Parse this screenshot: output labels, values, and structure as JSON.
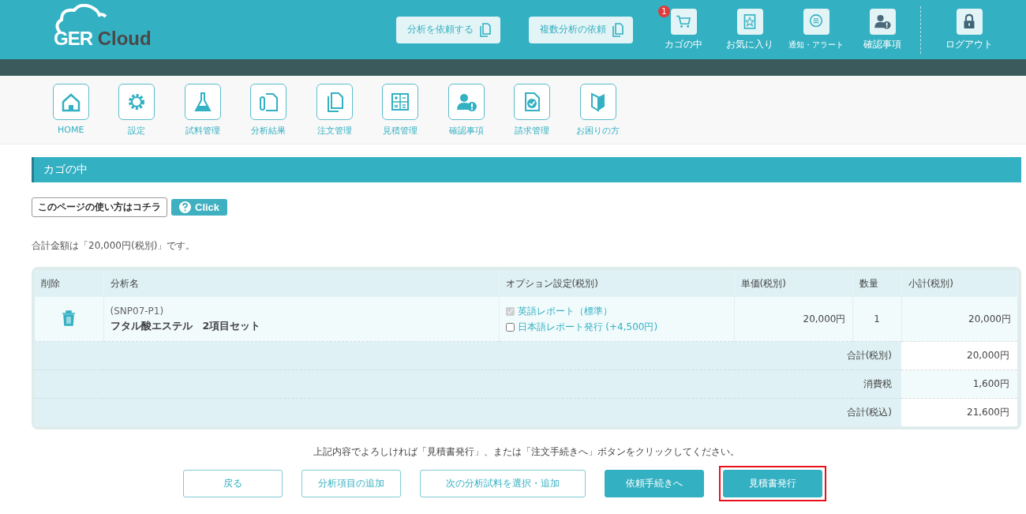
{
  "header": {
    "logo": {
      "part_1": "GER",
      "part_2": "Cloud"
    },
    "request_buttons": [
      "分析を依頼する",
      "複数分析の依頼"
    ],
    "icons": [
      {
        "label": "カゴの中",
        "badge": "1"
      },
      {
        "label": "お気に入り"
      },
      {
        "label": "通知・アラート"
      },
      {
        "label": "確認事項"
      }
    ],
    "logout": "ログアウト"
  },
  "nav": [
    "HOME",
    "設定",
    "試料管理",
    "分析結果",
    "注文管理",
    "見積管理",
    "確認事項",
    "請求管理",
    "お困りの方"
  ],
  "page_title": "カゴの中",
  "help": {
    "label": "このページの使い方はコチラ",
    "button": "Click"
  },
  "total_text": "合計金額は「20,000円(税別)」です。",
  "table": {
    "columns": [
      "削除",
      "分析名",
      "オプション設定(税別)",
      "単価(税別)",
      "数量",
      "小計(税別)"
    ],
    "rows": [
      {
        "code": "(SNP07-P1)",
        "name": "フタル酸エステル　2項目セット",
        "options": [
          {
            "label": "英語レポート（標準）",
            "checked": true,
            "disabled": true
          },
          {
            "label": "日本語レポート発行 (+4,500円)",
            "checked": false,
            "disabled": false
          }
        ],
        "price": "20,000円",
        "qty": "1",
        "subtotal": "20,000円"
      }
    ],
    "summary": [
      {
        "label": "合計(税別)",
        "value": "20,000円"
      },
      {
        "label": "消費税",
        "value": "1,600円"
      },
      {
        "label": "合計(税込)",
        "value": "21,600円"
      }
    ]
  },
  "message": "上記内容でよろしければ「見積書発行」、または「注文手続きへ」ボタンをクリックしてください。",
  "buttons": [
    {
      "label": "戻る",
      "kind": "outline",
      "highlighted": false
    },
    {
      "label": "分析項目の追加",
      "kind": "outline",
      "highlighted": false
    },
    {
      "label": "次の分析試料を選択・追加",
      "kind": "outline",
      "highlighted": false
    },
    {
      "label": "依頼手続きへ",
      "kind": "filled",
      "highlighted": false
    },
    {
      "label": "見積書発行",
      "kind": "filled",
      "highlighted": true
    }
  ]
}
